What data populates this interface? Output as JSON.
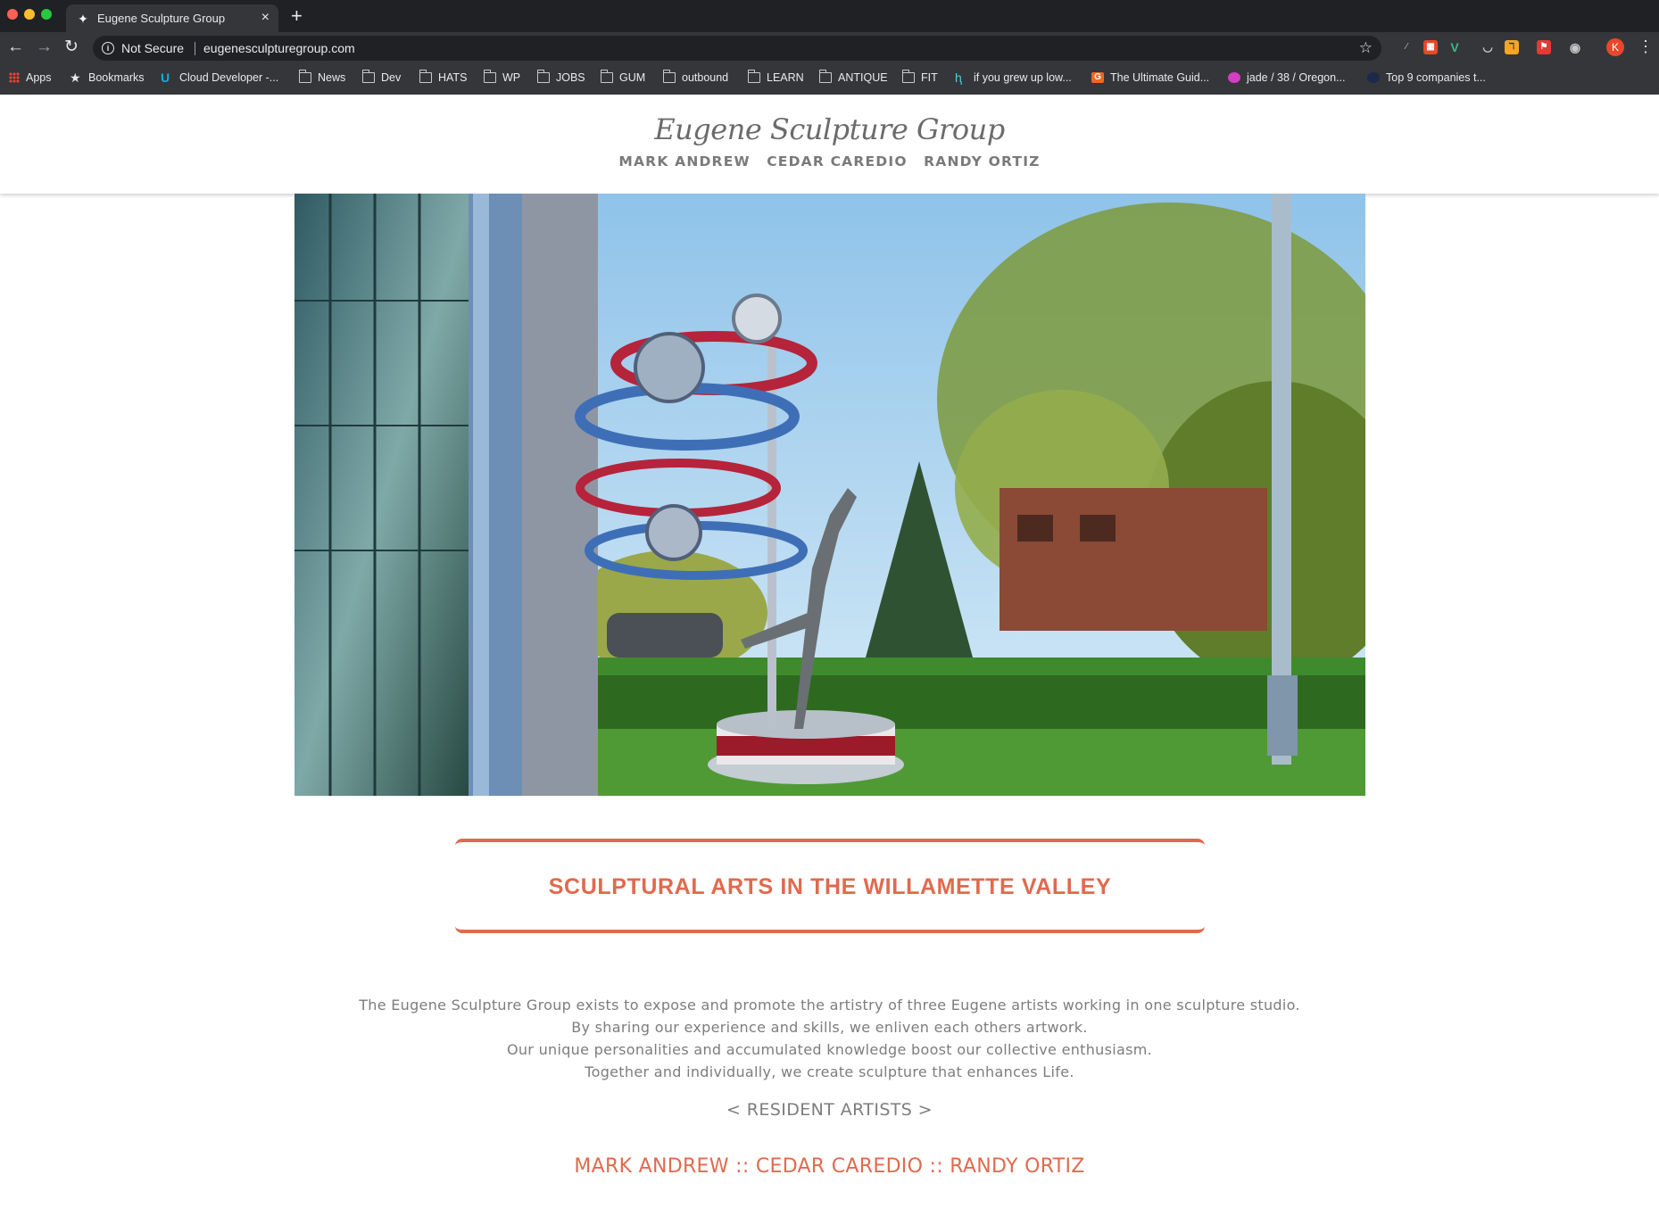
{
  "browser": {
    "tab_title": "Eugene Sculpture Group",
    "security_label": "Not Secure",
    "url": "eugenesculpturegroup.com",
    "profile_initial": "K",
    "bookmarks": [
      {
        "label": "Apps",
        "icon": "apps-grid-icon"
      },
      {
        "label": "Bookmarks",
        "icon": "star-icon"
      },
      {
        "label": "Cloud Developer -...",
        "icon": "udacity-icon"
      },
      {
        "label": "News",
        "icon": "folder-icon"
      },
      {
        "label": "Dev",
        "icon": "folder-icon"
      },
      {
        "label": "HATS",
        "icon": "folder-icon"
      },
      {
        "label": "WP",
        "icon": "folder-icon"
      },
      {
        "label": "JOBS",
        "icon": "folder-icon"
      },
      {
        "label": "GUM",
        "icon": "folder-icon"
      },
      {
        "label": "outbound",
        "icon": "folder-icon"
      },
      {
        "label": "LEARN",
        "icon": "folder-icon"
      },
      {
        "label": "ANTIQUE",
        "icon": "folder-icon"
      },
      {
        "label": "FIT",
        "icon": "folder-icon"
      },
      {
        "label": "if you grew up low...",
        "icon": "page-icon"
      },
      {
        "label": "The Ultimate Guid...",
        "icon": "g-icon"
      },
      {
        "label": "jade / 38 / Oregon...",
        "icon": "okcupid-icon"
      },
      {
        "label": "Top 9 companies t...",
        "icon": "globe-icon"
      }
    ]
  },
  "site": {
    "logo": "Eugene Sculpture Group",
    "nav": [
      "MARK ANDREW",
      "CEDAR CAREDIO",
      "RANDY ORTIZ"
    ],
    "headline": "SCULPTURAL ARTS IN THE WILLAMETTE VALLEY",
    "intro": [
      "The Eugene Sculpture Group exists to expose and promote the artistry of three Eugene artists working in one sculpture studio.",
      "By sharing our experience and skills, we enliven each others artwork.",
      "Our unique personalities and accumulated knowledge boost our collective enthusiasm.",
      "Together and individually, we create sculpture that enhances Life."
    ],
    "resident_label": "< RESIDENT ARTISTS >",
    "artists": [
      "MARK ANDREW",
      "CEDAR CAREDIO",
      "RANDY ORTIZ"
    ],
    "artists_separator": " :: "
  },
  "colors": {
    "accent": "#e06a4e",
    "text_gray": "#7d7d7d",
    "chrome_dark": "#202124",
    "chrome_mid": "#35363a"
  }
}
